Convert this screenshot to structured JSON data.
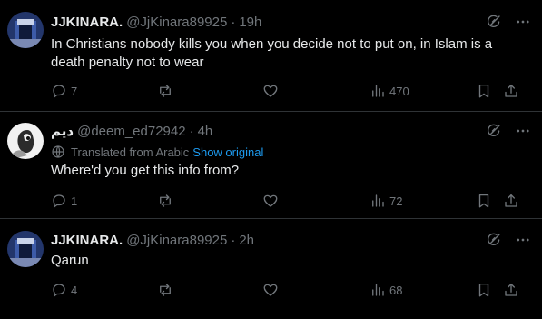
{
  "tweets": [
    {
      "name": "JJKINARA.",
      "handle": "@JjKinara89925",
      "time": "19h",
      "text": "In Christians nobody kills you when you decide not to put on, in Islam is a death penalty not to wear",
      "translated": null,
      "replies": "7",
      "reposts": "",
      "likes": "",
      "views": "470"
    },
    {
      "name": "ديم",
      "handle": "@deem_ed72942",
      "time": "4h",
      "text": "Where'd you get this info from?",
      "translated": {
        "label": "Translated from Arabic",
        "link": "Show original"
      },
      "replies": "1",
      "reposts": "",
      "likes": "",
      "views": "72"
    },
    {
      "name": "JJKINARA.",
      "handle": "@JjKinara89925",
      "time": "2h",
      "text": "Qarun",
      "translated": null,
      "replies": "4",
      "reposts": "",
      "likes": "",
      "views": "68"
    }
  ],
  "separator": "·",
  "colors": {
    "background": "#000000",
    "text": "#e7e9ea",
    "muted": "#71767b",
    "link": "#1d9bf0",
    "border": "#2f3336"
  }
}
